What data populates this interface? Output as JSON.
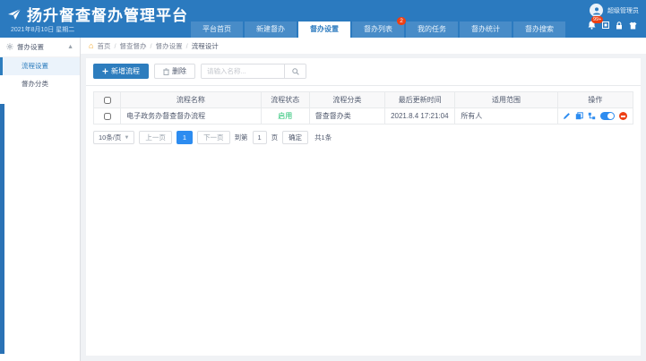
{
  "header": {
    "app_title": "扬升督查督办管理平台",
    "date": "2021年8月10日 星期二",
    "user_name": "超级管理员",
    "notification_badge": "99+",
    "icons": [
      "paper-plane-logo-icon",
      "user-avatar-icon",
      "bell-icon",
      "fullscreen-icon",
      "lock-icon",
      "logout-icon"
    ]
  },
  "nav": {
    "tabs": [
      {
        "label": "平台首页",
        "active": false
      },
      {
        "label": "新建督办",
        "active": false
      },
      {
        "label": "督办设置",
        "active": true
      },
      {
        "label": "督办列表",
        "active": false,
        "badge": "2"
      },
      {
        "label": "我的任务",
        "active": false
      },
      {
        "label": "督办统计",
        "active": false
      },
      {
        "label": "督办搜索",
        "active": false
      }
    ]
  },
  "sidebar": {
    "group_label": "督办设置",
    "group_icon": "gear-icon",
    "items": [
      {
        "label": "流程设置",
        "active": true
      },
      {
        "label": "督办分类",
        "active": false
      }
    ]
  },
  "breadcrumb": {
    "items": [
      "首页",
      "督查督办",
      "督办设置",
      "流程设计"
    ]
  },
  "toolbar": {
    "add_label": "新增流程",
    "delete_label": "删除",
    "search_placeholder": "请输入名称..."
  },
  "table": {
    "columns": [
      "流程名称",
      "流程状态",
      "流程分类",
      "最后更新时间",
      "适用范围",
      "操作"
    ],
    "rows": [
      {
        "name": "电子政务办督查督办流程",
        "status": "启用",
        "category": "督查督办类",
        "updated": "2021.8.4 17:21:04",
        "scope": "所有人",
        "op_icons": [
          "edit-icon",
          "copy-icon",
          "design-icon",
          "enable-toggle",
          "forbid-icon"
        ]
      }
    ]
  },
  "pagination": {
    "page_size": "10条/页",
    "prev_label": "上一页",
    "current_page": "1",
    "next_label": "下一页",
    "goto_prefix": "到第",
    "goto_value": "1",
    "goto_suffix": "页",
    "confirm_label": "确定",
    "total_label": "共1条"
  },
  "colors": {
    "header_blue": "#2b7abf",
    "accent_blue": "#2d7dbe",
    "link_blue": "#2d8cf0",
    "status_green": "#19be6b",
    "danger_red": "#ed4014",
    "home_orange": "#f5a623"
  }
}
